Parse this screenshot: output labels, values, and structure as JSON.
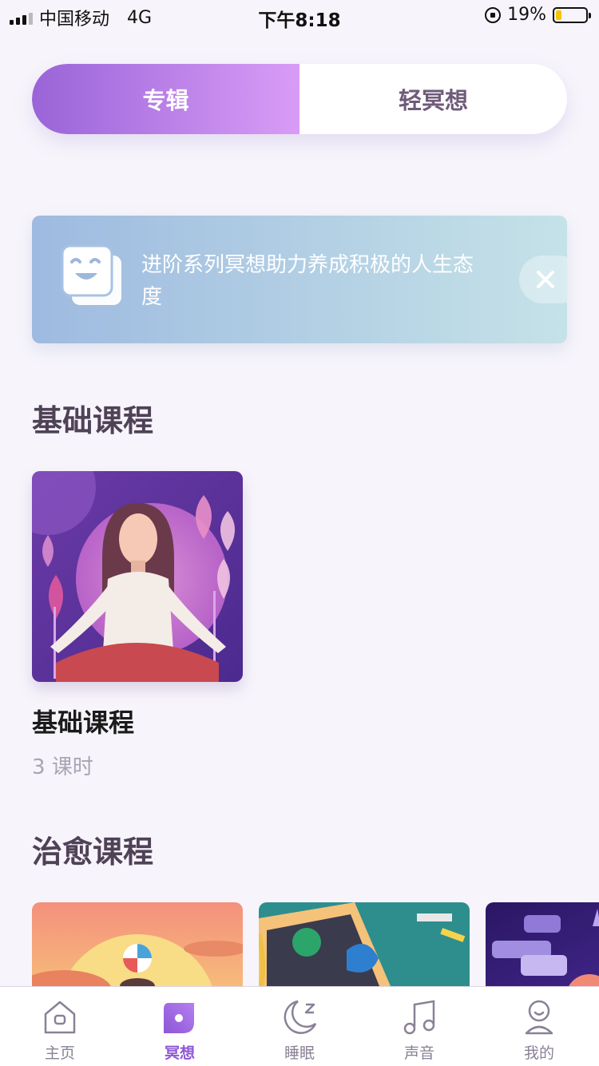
{
  "status_bar": {
    "carrier": "中国移动",
    "network": "4G",
    "time": "下午8:18",
    "battery_percent": "19%",
    "battery_level": 0.19,
    "battery_fill_color": "#f6c400"
  },
  "segment": {
    "tabs": [
      {
        "label": "专辑",
        "active": true
      },
      {
        "label": "轻冥想",
        "active": false
      }
    ],
    "active_gradient": [
      "#9a64d8",
      "#d99cf6"
    ]
  },
  "banner": {
    "text": "进阶系列冥想助力养成积极的人生态度",
    "icon": "smiley-cards-icon",
    "close_icon": "close-icon"
  },
  "sections": [
    {
      "title": "基础课程",
      "items": [
        {
          "name": "基础课程",
          "meta": "3 课时",
          "image": "meditating-woman-illustration"
        }
      ]
    },
    {
      "title": "治愈课程",
      "items": [
        {
          "image": "sunset-beach-ball-illustration"
        },
        {
          "image": "art-canvas-paint-illustration"
        },
        {
          "image": "night-chat-bubbles-illustration"
        }
      ]
    }
  ],
  "tabbar": {
    "accent": "#8d56d6",
    "items": [
      {
        "label": "主页",
        "icon": "home-icon",
        "active": false
      },
      {
        "label": "冥想",
        "icon": "meditation-icon",
        "active": true
      },
      {
        "label": "睡眠",
        "icon": "moon-sleep-icon",
        "active": false
      },
      {
        "label": "声音",
        "icon": "music-note-icon",
        "active": false
      },
      {
        "label": "我的",
        "icon": "profile-icon",
        "active": false
      }
    ]
  }
}
